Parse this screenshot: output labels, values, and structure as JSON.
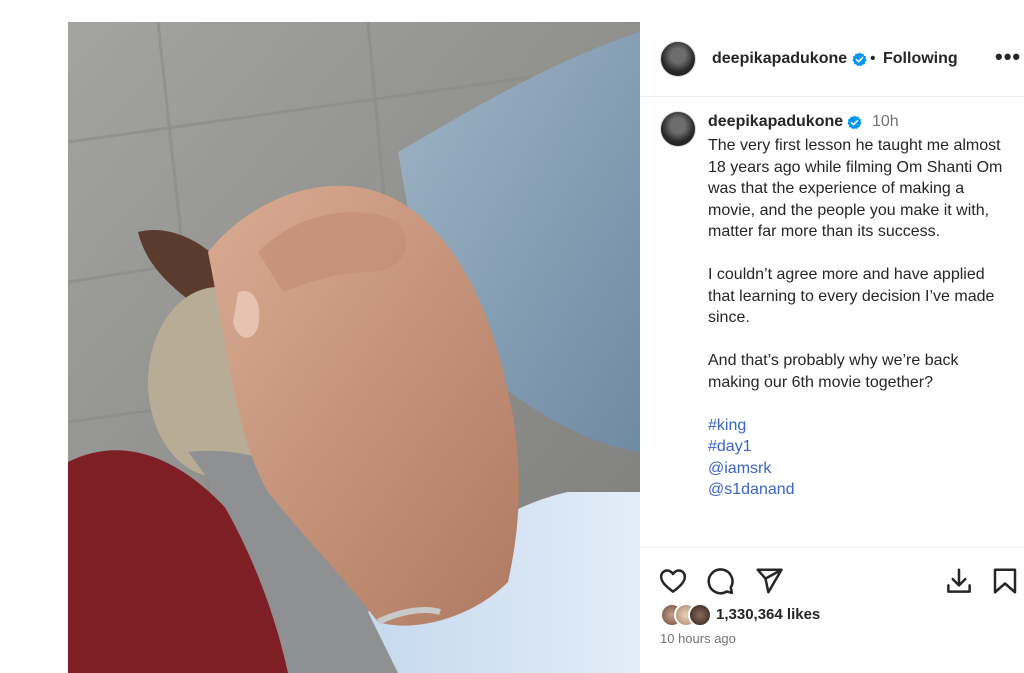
{
  "post": {
    "username": "deepikapadukone",
    "separator": "•",
    "follow_state": "Following",
    "more_label": "•••",
    "caption_time": "10h",
    "caption_paragraphs": [
      "The very first lesson he taught me almost 18 years ago while filming Om Shanti Om was that the experience of making a movie, and the people you make it with, matter far more than its success.",
      "I couldn’t agree more and have applied that learning to every decision I’ve made since.",
      "And that’s probably why we’re back making our 6th movie together?"
    ],
    "tags": [
      "#king",
      "#day1",
      "@iamsrk",
      "@s1danand"
    ],
    "likes": "1,330,364 likes",
    "posted_ago": "10 hours ago"
  },
  "icons": {
    "verified": "verified-badge-icon",
    "like": "heart-icon",
    "comment": "comment-icon",
    "share": "send-icon",
    "download": "download-icon",
    "save": "bookmark-icon"
  },
  "colors": {
    "verified_blue": "#0095f6",
    "link_blue": "#3b64c4",
    "secondary_text": "#737373"
  }
}
